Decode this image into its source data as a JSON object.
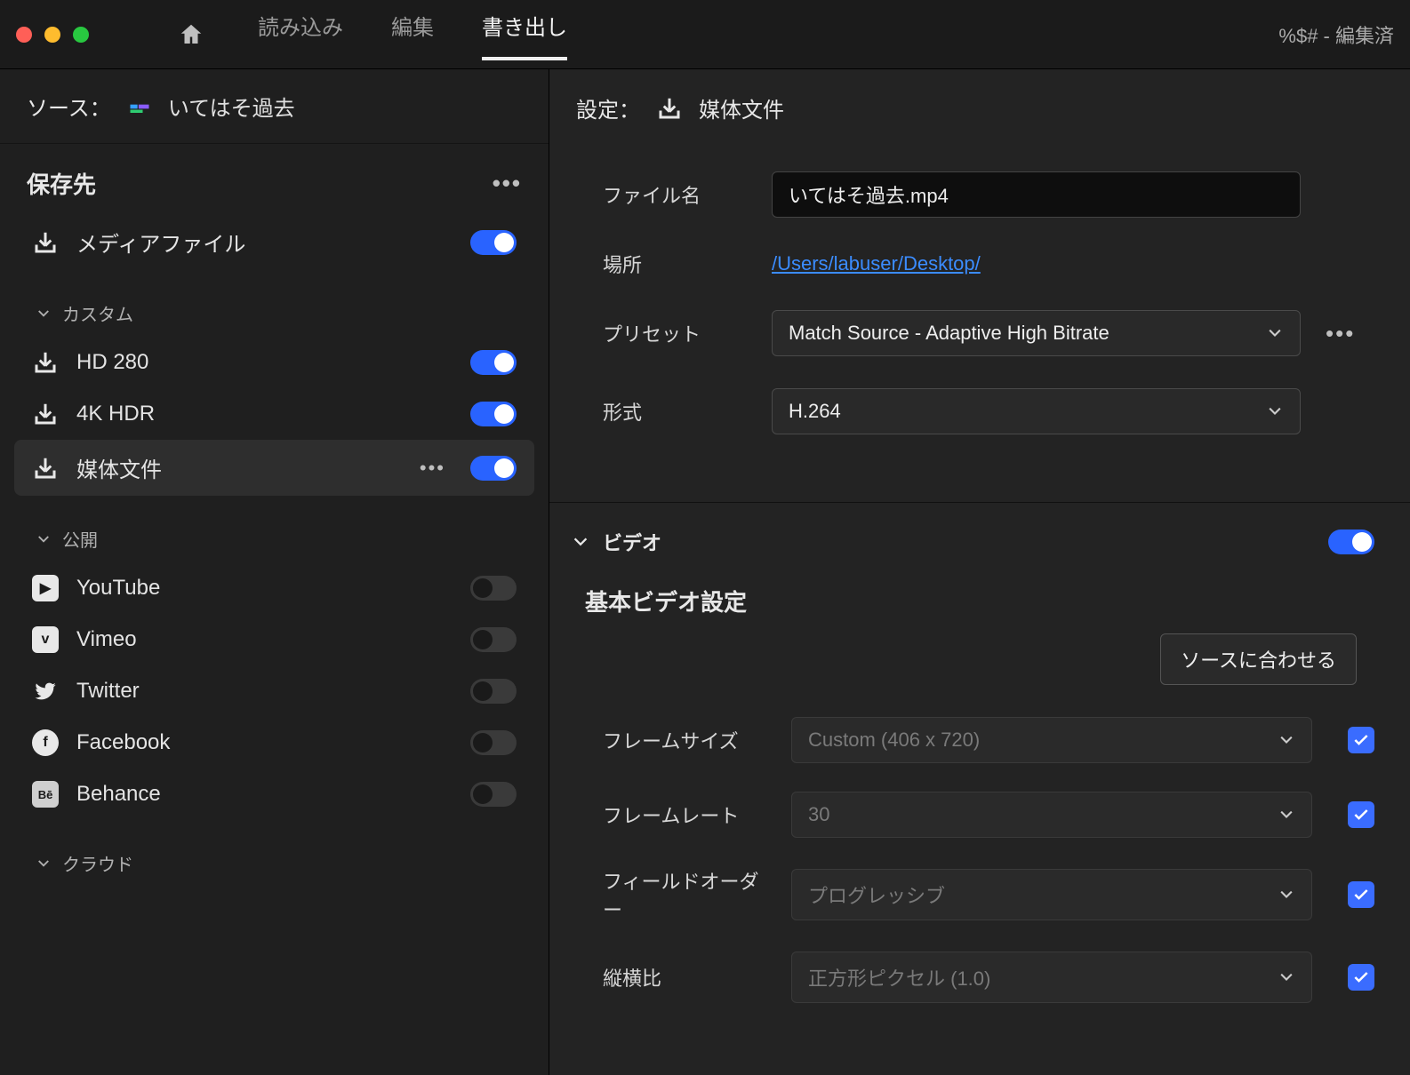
{
  "titlebar": {
    "tabs": [
      "読み込み",
      "編集",
      "書き出し"
    ],
    "active_tab_index": 2,
    "right_text": "%$# - 編集済"
  },
  "source": {
    "label": "ソース：",
    "name": "いてはそ過去"
  },
  "sidebar": {
    "header": "保存先",
    "media_file": {
      "label": "メディアファイル",
      "on": true
    },
    "custom_header": "カスタム",
    "custom": [
      {
        "label": "HD 280",
        "on": true
      },
      {
        "label": "4K HDR",
        "on": true
      },
      {
        "label": "媒体文件",
        "on": true,
        "selected": true,
        "show_dots": true
      }
    ],
    "publish_header": "公開",
    "publish": [
      {
        "label": "YouTube",
        "on": false,
        "brand": "yt"
      },
      {
        "label": "Vimeo",
        "on": false,
        "brand": "vm"
      },
      {
        "label": "Twitter",
        "on": false,
        "brand": "tw"
      },
      {
        "label": "Facebook",
        "on": false,
        "brand": "fb"
      },
      {
        "label": "Behance",
        "on": false,
        "brand": "be"
      }
    ],
    "cloud_header": "クラウド"
  },
  "settings": {
    "header_label": "設定：",
    "header_name": "媒体文件",
    "filename_label": "ファイル名",
    "filename_value": "いてはそ過去.mp4",
    "location_label": "場所",
    "location_value": "/Users/labuser/Desktop/",
    "preset_label": "プリセット",
    "preset_value": "Match Source - Adaptive High Bitrate",
    "format_label": "形式",
    "format_value": "H.264"
  },
  "video": {
    "section_title": "ビデオ",
    "section_on": true,
    "subheader": "基本ビデオ設定",
    "match_button": "ソースに合わせる",
    "rows": {
      "frame_size": {
        "label": "フレームサイズ",
        "value": "Custom (406 x 720)",
        "checked": true
      },
      "frame_rate": {
        "label": "フレームレート",
        "value": "30",
        "checked": true
      },
      "field_order": {
        "label": "フィールドオーダー",
        "value": "プログレッシブ",
        "checked": true
      },
      "aspect_ratio": {
        "label": "縦横比",
        "value": "正方形ピクセル (1.0)",
        "checked": true
      }
    }
  }
}
